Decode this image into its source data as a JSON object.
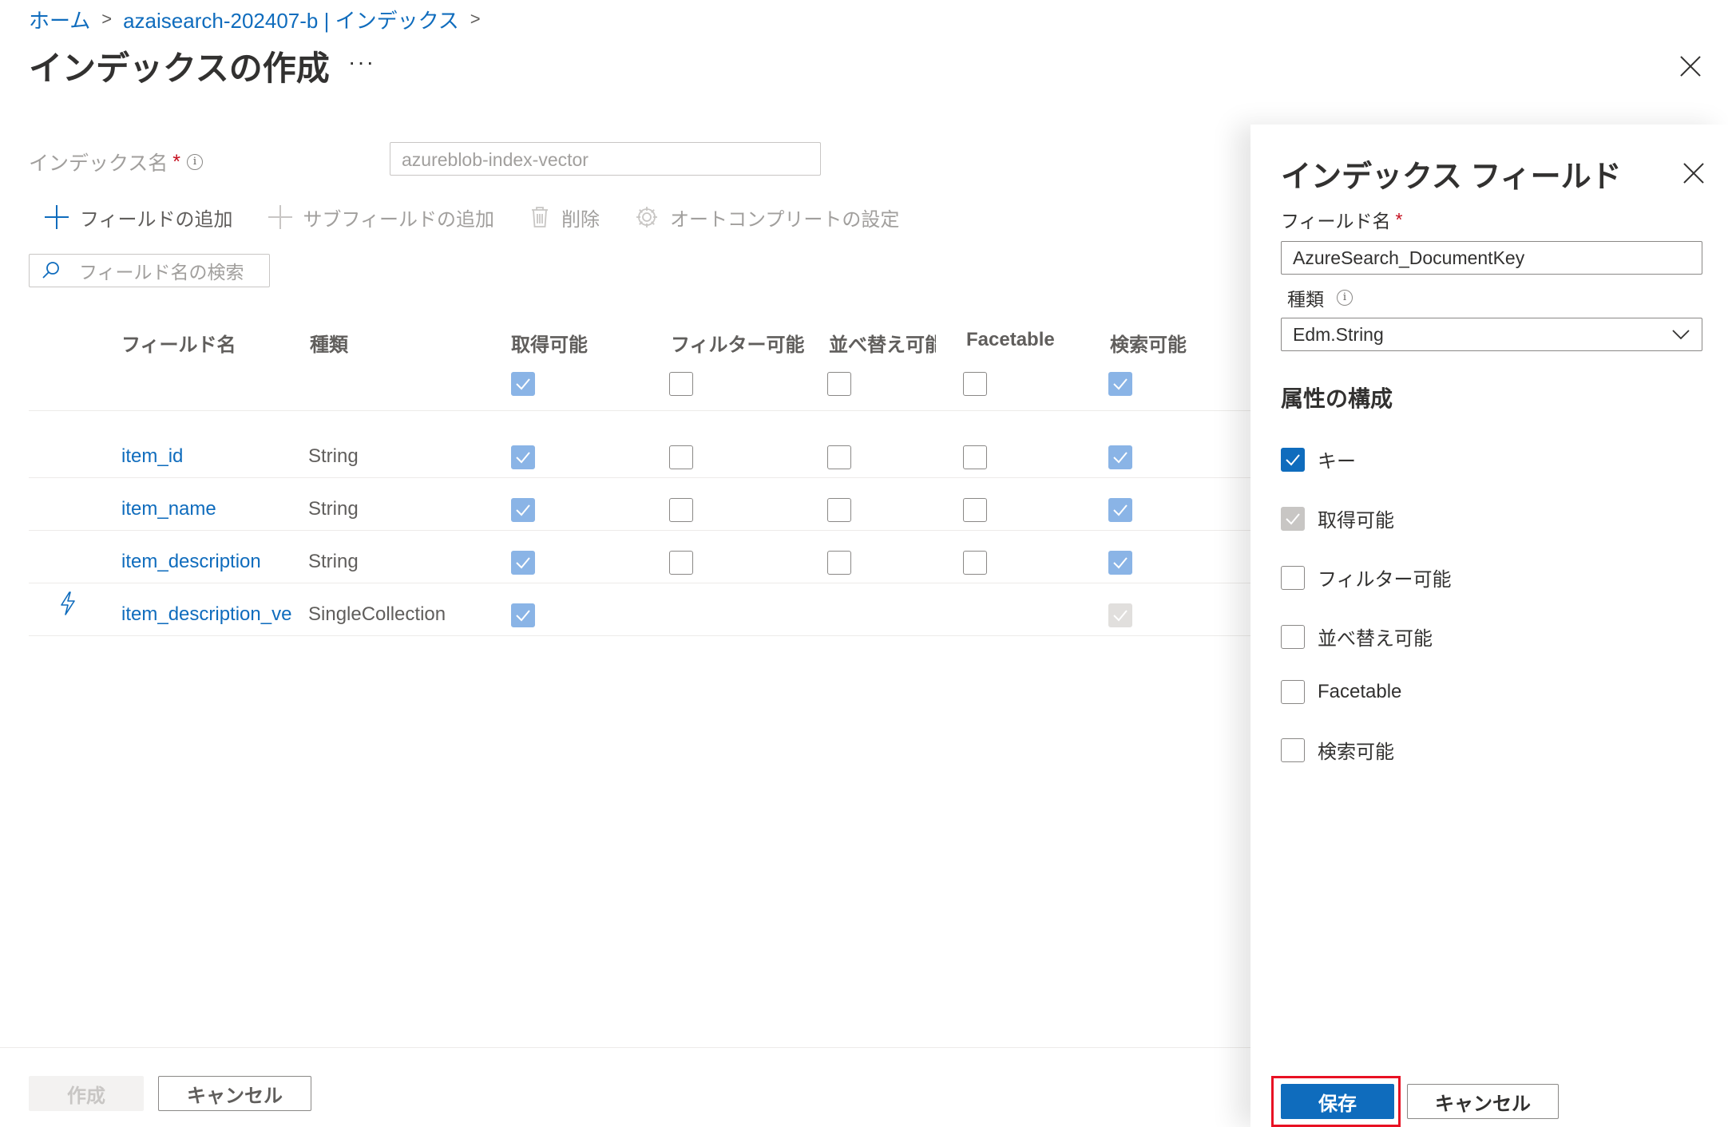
{
  "breadcrumb": {
    "home": "ホーム",
    "service": "azaisearch-202407-b | インデックス"
  },
  "page": {
    "title": "インデックスの作成",
    "more": "···"
  },
  "index_name": {
    "label": "インデックス名",
    "required": "*",
    "value": "azureblob-index-vector"
  },
  "toolbar": {
    "add_field": "フィールドの追加",
    "add_subfield": "サブフィールドの追加",
    "delete": "削除",
    "autocomplete": "オートコンプリートの設定"
  },
  "search": {
    "placeholder": "フィールド名の検索"
  },
  "grid": {
    "headers": {
      "name": "フィールド名",
      "type": "種類",
      "retrievable": "取得可能",
      "filterable": "フィルター可能",
      "sortable": "並べ替え可能",
      "facetable": "Facetable",
      "searchable": "検索可能"
    },
    "header_checks": {
      "retrievable": true,
      "filterable": false,
      "sortable": false,
      "facetable": false,
      "searchable": true
    },
    "rows": [
      {
        "name": "item_id",
        "type": "String",
        "retrievable": true,
        "filterable": false,
        "sortable": false,
        "facetable": false,
        "searchable": true
      },
      {
        "name": "item_name",
        "type": "String",
        "retrievable": true,
        "filterable": false,
        "sortable": false,
        "facetable": false,
        "searchable": true
      },
      {
        "name": "item_description",
        "type": "String",
        "retrievable": true,
        "filterable": false,
        "sortable": false,
        "facetable": false,
        "searchable": true
      },
      {
        "name": "item_description_vec",
        "type": "SingleCollection",
        "retrievable": true,
        "searchable": true
      }
    ]
  },
  "footer": {
    "create": "作成",
    "cancel": "キャンセル"
  },
  "panel": {
    "title": "インデックス フィールド",
    "field_name_label": "フィールド名",
    "field_name_required": "*",
    "field_name_value": "AzureSearch_DocumentKey",
    "type_label": "種類",
    "type_value": "Edm.String",
    "section_title": "属性の構成",
    "attributes": {
      "key": "キー",
      "retrievable": "取得可能",
      "filterable": "フィルター可能",
      "sortable": "並べ替え可能",
      "facetable": "Facetable",
      "searchable": "検索可能"
    },
    "save": "保存",
    "cancel": "キャンセル"
  },
  "colors": {
    "accent": "#0f6cbd",
    "highlight": "#e81123"
  }
}
